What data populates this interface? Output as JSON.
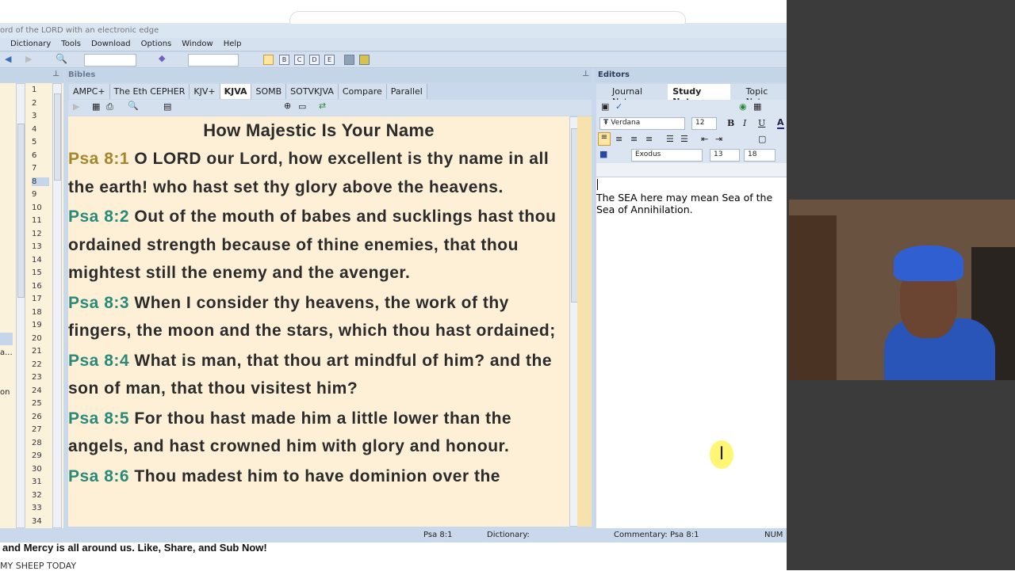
{
  "window": {
    "title": "ord of the LORD with an electronic edge"
  },
  "menu": [
    "Dictionary",
    "Tools",
    "Download",
    "Options",
    "Window",
    "Help"
  ],
  "toolbar": {
    "view_buttons": [
      "B",
      "C",
      "D",
      "E"
    ]
  },
  "left_panel": {
    "numbers": [
      "1",
      "2",
      "3",
      "4",
      "5",
      "6",
      "7",
      "8",
      "9",
      "10",
      "11",
      "12",
      "13",
      "14",
      "15",
      "16",
      "17",
      "18",
      "19",
      "20",
      "21",
      "22",
      "23",
      "24",
      "25",
      "26",
      "27",
      "28",
      "29",
      "30",
      "31",
      "32",
      "33",
      "34"
    ],
    "selected": "8",
    "partial_items": [
      "a...",
      "on"
    ]
  },
  "bibles": {
    "header": "Bibles",
    "tabs": [
      "AMPC+",
      "The Eth CEPHER",
      "KJV+",
      "KJVA",
      "SOMB",
      "SOTVKJVA",
      "Compare",
      "Parallel"
    ],
    "active_tab": "KJVA",
    "heading": "How Majestic Is Your Name",
    "verses": [
      {
        "ref": "Psa 8:1",
        "text": "O LORD our Lord, how excellent is thy name in all the earth! who hast set thy glory above the heavens."
      },
      {
        "ref": "Psa 8:2",
        "text": "Out of the mouth of babes and sucklings hast thou ordained strength because of thine enemies, that thou mightest still the enemy and the avenger."
      },
      {
        "ref": "Psa 8:3",
        "text": "When I consider thy heavens, the work of thy fingers, the moon and the stars, which thou hast ordained;"
      },
      {
        "ref": "Psa 8:4",
        "text": "What is man, that thou art mindful of him? and the son of man, that thou visitest him?"
      },
      {
        "ref": "Psa 8:5",
        "text": "For thou hast made him a little lower than the angels, and hast crowned him with glory and honour."
      },
      {
        "ref": "Psa 8:6",
        "text": "Thou madest him to have dominion over the"
      }
    ],
    "colors": {
      "first_ref": "#a5862a",
      "ref": "#2a8a7a",
      "background": "#fdf0d6"
    }
  },
  "editors": {
    "header": "Editors",
    "tabs": [
      "Journal Notes",
      "Study Notes",
      "Topic Not"
    ],
    "active_tab": "Study Notes",
    "font": "Verdana",
    "size": "12",
    "format": [
      "B",
      "I",
      "U",
      "A"
    ],
    "book": "Exodus",
    "chapter": "13",
    "verse": "18",
    "content_line1": "The SEA here may mean Sea of the",
    "content_line2": "Sea of Annihilation."
  },
  "status": {
    "ref": "Psa 8:1",
    "dictionary": "Dictionary:",
    "commentary": "Commentary: Psa 8:1",
    "num": "NUM"
  },
  "overlay": {
    "banner": "and Mercy is all around us. Like, Share, and Sub Now!",
    "channel": "MY SHEEP TODAY"
  }
}
